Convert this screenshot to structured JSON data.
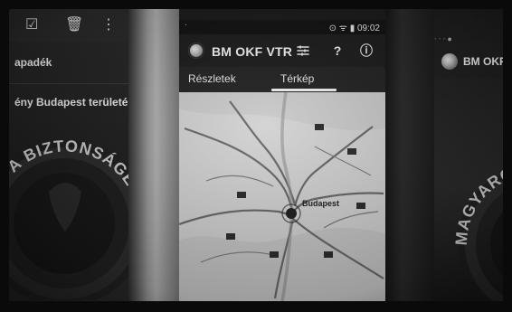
{
  "left_panel": {
    "icons": [
      "checkbox-icon",
      "trash-icon",
      "more-vert-icon"
    ],
    "items": [
      {
        "label": "apadék"
      },
      {
        "label": "ény Budapest területén"
      }
    ],
    "seal_text": "ÁTÁBAN A BIZTONSÁGÉRT"
  },
  "center_phone": {
    "status_left": "ᐧ",
    "status_right": "⊙ ᯤ ▮ 09:02",
    "app_title": "BM OKF VTR",
    "appbar_icons": [
      "filter-icon",
      "help-icon",
      "info-icon"
    ],
    "tabs": [
      {
        "label": "Részletek"
      },
      {
        "label": "Térkép"
      }
    ],
    "map": {
      "city_label": "Budapest"
    }
  },
  "right_panel": {
    "status_text": "ᐧ ᐧ ᐧ ●",
    "app_title": "BM OKF VTR",
    "seal_text": "MAGYARORSZÁG SZOLG"
  },
  "colors": {
    "tint": "#d0d0d0",
    "appbar": "#1d1d1d",
    "text": "#f5f5f5"
  }
}
